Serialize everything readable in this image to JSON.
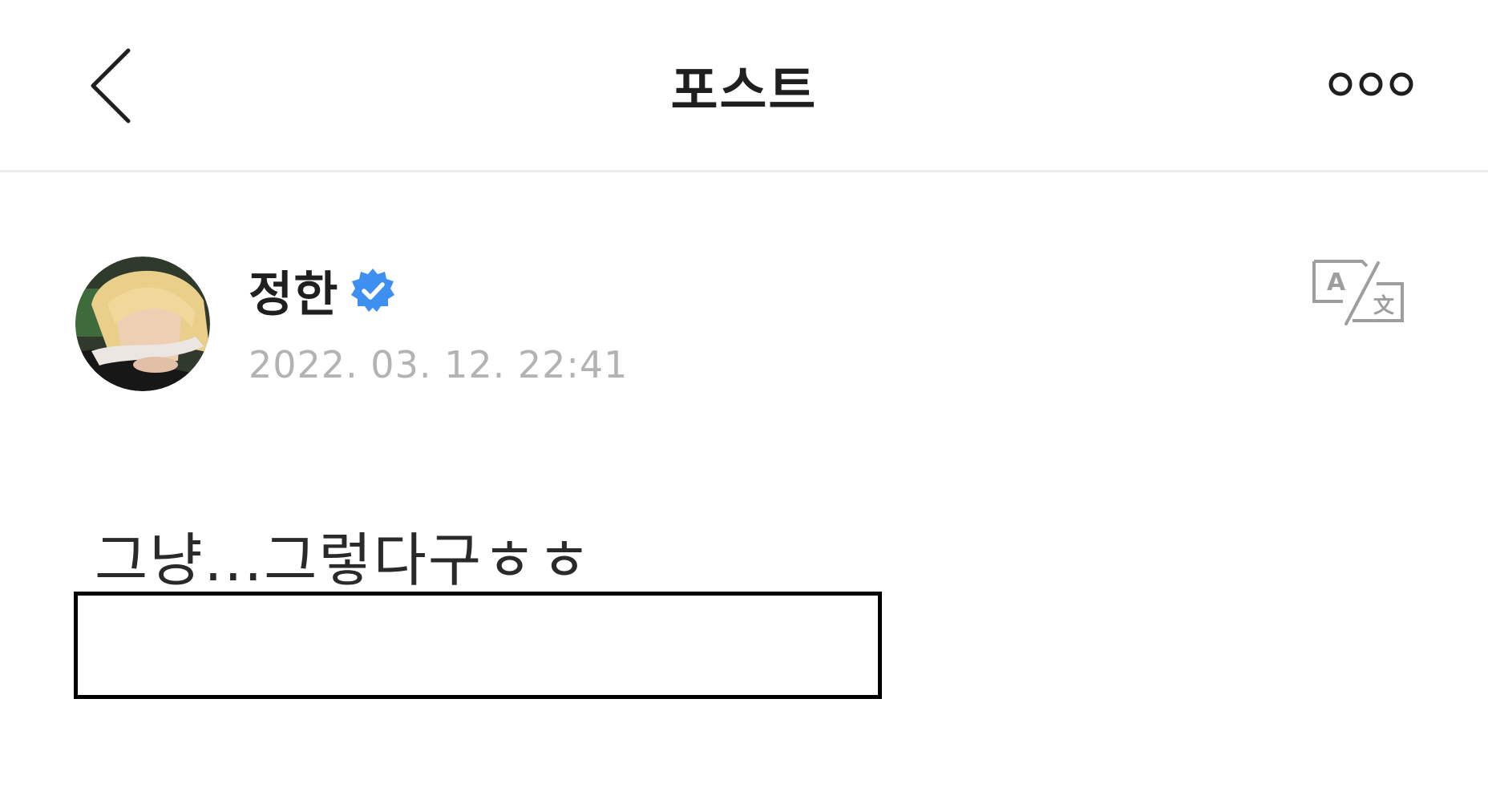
{
  "header": {
    "title": "포스트",
    "back_icon": "chevron-left-icon",
    "more_icon": "more-dots-icon"
  },
  "post": {
    "author": {
      "name": "정한",
      "verified_icon": "verified-badge-icon",
      "verified_color": "#3d8ff0"
    },
    "timestamp": "2022. 03. 12. 22:41",
    "translate_icon": "translate-icon",
    "text": "그냥...그렇다구ㅎㅎ"
  }
}
